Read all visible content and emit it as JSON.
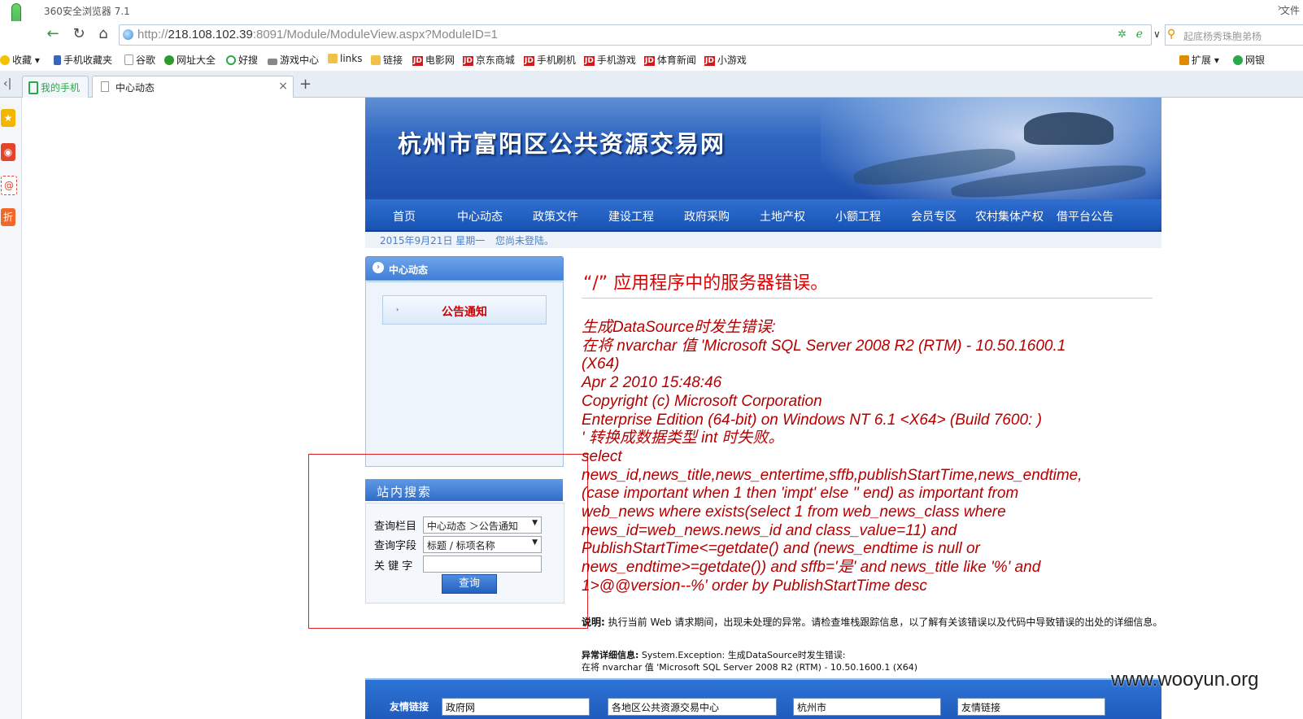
{
  "browser": {
    "window_title": "360安全浏览器 7.1",
    "menu_label": "文件",
    "address": {
      "url_prefix": "http://",
      "host": "218.108.102.39",
      "url_rest": ":8091/Module/ModuleView.aspx?ModuleID=1"
    },
    "search_placeholder": "起底杨秀珠胞弟杨",
    "bookmarks": [
      {
        "label": "收藏",
        "icon": "star-icon"
      },
      {
        "label": "手机收藏夹",
        "icon": "phone-icon"
      },
      {
        "label": "谷歌",
        "icon": "page-icon"
      },
      {
        "label": "网址大全",
        "icon": "globe-icon"
      },
      {
        "label": "好搜",
        "icon": "search-icon"
      },
      {
        "label": "游戏中心",
        "icon": "gamepad-icon"
      },
      {
        "label": "links",
        "icon": "folder-icon"
      },
      {
        "label": "链接",
        "icon": "folder-icon"
      },
      {
        "label": "电影网",
        "icon": "jd-icon"
      },
      {
        "label": "京东商城",
        "icon": "jd-icon"
      },
      {
        "label": "手机刷机",
        "icon": "jd-icon"
      },
      {
        "label": "手机游戏",
        "icon": "jd-icon"
      },
      {
        "label": "体育新闻",
        "icon": "jd-icon"
      },
      {
        "label": "小游戏",
        "icon": "jd-icon"
      }
    ],
    "jd_text": "JD",
    "ext_label": "扩展",
    "bank_label": "网银",
    "tabs": [
      {
        "label": "我的手机"
      },
      {
        "label": "中心动态"
      }
    ],
    "new_tab": "+",
    "close_tab": "×",
    "sidebar_glyphs": [
      "★",
      "◉",
      "@",
      "折"
    ]
  },
  "site": {
    "title": "杭州市富阳区公共资源交易网",
    "nav": [
      "首页",
      "中心动态",
      "政策文件",
      "建设工程",
      "政府采购",
      "土地产权",
      "小额工程",
      "会员专区",
      "农村集体产权",
      "借平台公告"
    ],
    "date": "2015年9月21日  星期一",
    "login_status": "您尚未登陆。",
    "left_header": "中心动态",
    "left_item": "公告通知",
    "search": {
      "header": "站内搜索",
      "column_label": "查询栏目",
      "column_value": "中心动态 ＞公告通知",
      "field_label": "查询字段",
      "field_value": "标题 / 标项名称",
      "keyword_label": "关 键 字",
      "keyword_value": "",
      "button": "查询"
    },
    "footer": {
      "label1": "友情链接",
      "sel1": "政府网",
      "sel2": "各地区公共资源交易中心",
      "sel3": "杭州市",
      "sel4": "友情链接"
    }
  },
  "error": {
    "title": "“/” 应用程序中的服务器错误。",
    "lines": [
      "生成DataSource时发生错误:",
      "在将 nvarchar 值 'Microsoft SQL Server 2008 R2 (RTM) - 10.50.1600.1",
      "(X64)",
      "Apr  2 2010 15:48:46",
      "Copyright (c) Microsoft Corporation",
      "Enterprise Edition (64-bit) on Windows NT 6.1 <X64> (Build 7600: )",
      "' 转换成数据类型 int 时失败。",
      "select",
      "news_id,news_title,news_entertime,sffb,publishStartTime,news_endtime,",
      "(case important when 1 then 'impt' else '' end) as important from",
      "web_news where exists(select 1 from web_news_class where",
      "news_id=web_news.news_id and class_value=11) and",
      "PublishStartTime<=getdate() and (news_endtime is null or",
      "news_endtime>=getdate()) and sffb='是' and news_title like '%' and",
      "1>@@version--%' order by PublishStartTime desc"
    ],
    "desc_label": "说明:",
    "desc_text": " 执行当前 Web 请求期间，出现未处理的异常。请检查堆栈跟踪信息，以了解有关该错误以及代码中导致错误的出处的详细信息。",
    "exc_label": "异常详细信息:",
    "exc_text": " System.Exception: 生成DataSource时发生错误:",
    "exc_line2": "在将  nvarchar 值  'Microsoft SQL Server 2008 R2 (RTM) - 10.50.1600.1 (X64)"
  },
  "watermark": "www.wooyun.org",
  "colors": {
    "error_red": "#b40000",
    "nav_blue": "#1853b4",
    "highlight_box": "#e02020"
  }
}
